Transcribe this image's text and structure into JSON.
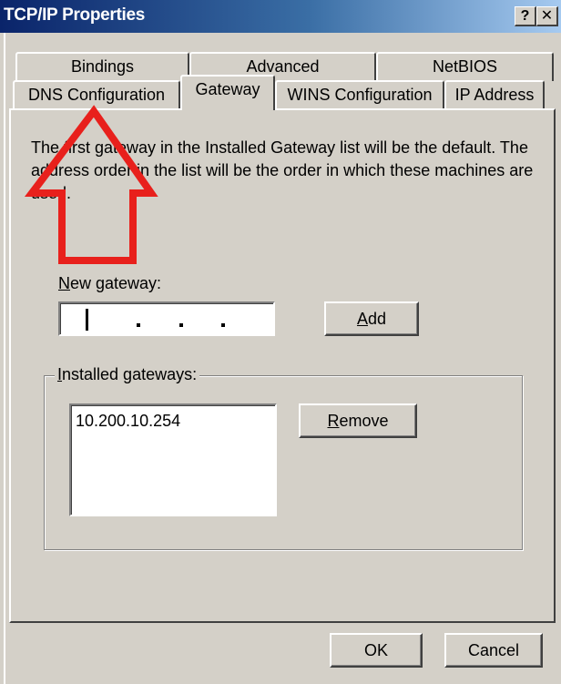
{
  "window": {
    "title": "TCP/IP Properties",
    "help_label": "?",
    "close_label": "✕"
  },
  "tabs": {
    "row1": [
      "Bindings",
      "Advanced",
      "NetBIOS"
    ],
    "row2": [
      "DNS Configuration",
      "Gateway",
      "WINS Configuration",
      "IP Address"
    ],
    "active": "Gateway"
  },
  "gateway_panel": {
    "description": "The first gateway in the Installed Gateway list will be the default. The address order in the list will be the order in which these machines are used.",
    "new_gateway_label_access_key": "N",
    "new_gateway_label_rest": "ew gateway:",
    "new_gateway_value": "",
    "add_label_access_key": "A",
    "add_label_rest": "dd",
    "installed_label_access_key": "I",
    "installed_label_rest": "nstalled gateways:",
    "installed_gateways": [
      "10.200.10.254"
    ],
    "remove_label_access_key": "R",
    "remove_label_rest": "emove"
  },
  "dialog_buttons": {
    "ok_label": "OK",
    "cancel_label": "Cancel"
  },
  "colors": {
    "titlebar_start": "#0a246a",
    "titlebar_end": "#a6caf0",
    "dialog_face": "#d4d0c8",
    "annotation_arrow": "#e8201c"
  },
  "annotation": {
    "icon": "red-up-arrow-icon"
  }
}
